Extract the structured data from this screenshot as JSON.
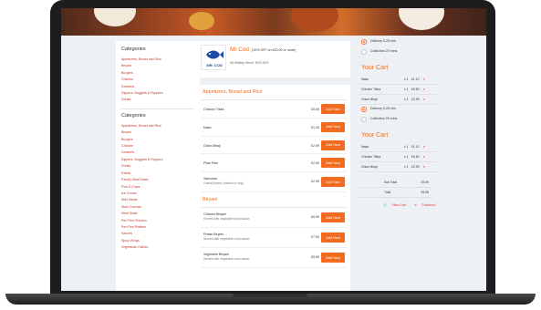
{
  "restaurant": {
    "name": "Mr Cod",
    "offer": "(10% OFF on £20.00 or more)",
    "address": "65 Whitley Street, RG2 0EG",
    "logo_text": "MR. COD"
  },
  "sidebar": {
    "top_title": "Categories",
    "top_items": [
      "Appetizers, Bread and Rice",
      "Biryani",
      "Burgers",
      "Chicken",
      "Desserts",
      "Dippers, Nuggets & Poppers",
      "Drinks"
    ],
    "bottom_title": "Categories",
    "bottom_items": [
      "Appetizers, Bread and Rice",
      "Biryani",
      "Burgers",
      "Chicken",
      "Desserts",
      "Dippers, Nuggets & Poppers",
      "Drinks",
      "Extras",
      "Family Meal Deals",
      "Fish & Chips",
      "Ice Cream",
      "Kids Meals",
      "Main Courses",
      "Meal Deals",
      "Peri Peri Chicken",
      "Peri Peri Platters",
      "Sauces",
      "Spicy Wings",
      "Vegetarian Dishes"
    ]
  },
  "menu": {
    "section1": "Appetizers, Bread and Rice",
    "items1": [
      {
        "name": "Chicken Tikka",
        "desc": "",
        "price": "£5.50",
        "button": "Add New"
      },
      {
        "name": "Naan",
        "desc": "",
        "price": "£1.10",
        "button": "Add New"
      },
      {
        "name": "Onion Bhaji",
        "desc": "",
        "price": "£2.99",
        "button": "Add New"
      },
      {
        "name": "Pilau Rice",
        "desc": "",
        "price": "£2.50",
        "button": "Add New"
      },
      {
        "name": "Samosas",
        "desc": "4 small (lamb, chicken or veg)",
        "price": "£2.99",
        "button": "Add New"
      }
    ],
    "section2": "Biryani",
    "items2": [
      {
        "name": "Chicken Biryani",
        "desc": "Served with vegetable curry sauce",
        "price": "£6.50",
        "button": "Add New"
      },
      {
        "name": "Prawn Biryani",
        "desc": "Served with vegetable curry sauce",
        "price": "£7.50",
        "button": "Add New"
      },
      {
        "name": "Vegetable Biryani",
        "desc": "Served with vegetable curry sauce",
        "price": "£5.50",
        "button": "Add New"
      }
    ]
  },
  "cart": {
    "delivery1": "Delivery 5-25 min",
    "collection1": "Collection 20 mins",
    "title1": "Your Cart",
    "lines1": [
      {
        "name": "Naan",
        "qty": "x 1",
        "price": "£1.10"
      },
      {
        "name": "Chicken Tikka",
        "qty": "x 1",
        "price": "£5.50"
      },
      {
        "name": "Onion Bhaji",
        "qty": "x 1",
        "price": "£2.99"
      }
    ],
    "delivery2": "Delivery 5-25 min",
    "collection2": "Collection 20 mins",
    "title2": "Your Cart",
    "lines2": [
      {
        "name": "Naan",
        "qty": "x 1",
        "price": "£1.10"
      },
      {
        "name": "Chicken Tikka",
        "qty": "x 1",
        "price": "£5.50"
      },
      {
        "name": "Onion Bhaji",
        "qty": "x 1",
        "price": "£2.99"
      }
    ],
    "remove_glyph": "×",
    "subtotal_label": "Sub Total",
    "subtotal_value": "£9.59",
    "total_label": "Total",
    "total_value": "£9.59",
    "view_cart": "View Cart",
    "checkout": "Checkout"
  },
  "colors": {
    "accent": "#f36b21",
    "link": "#c0392b",
    "remove": "#e23b3b"
  }
}
